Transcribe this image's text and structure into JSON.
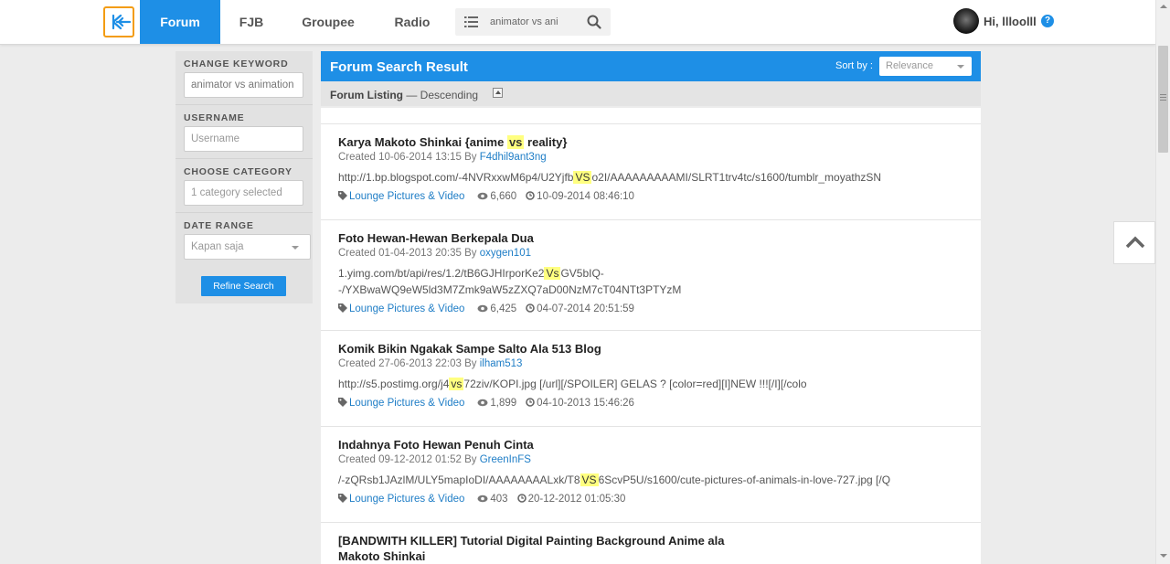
{
  "colors": {
    "brand_blue": "#1e8fe6",
    "logo_orange": "#f39c12",
    "highlight": "#ffff80",
    "link": "#1e7dc6"
  },
  "nav": {
    "logo_icon": "kaskus-k-logo",
    "tabs": [
      {
        "label": "Forum",
        "active": true
      },
      {
        "label": "FJB",
        "active": false
      },
      {
        "label": "Groupee",
        "active": false
      },
      {
        "label": "Radio",
        "active": false
      }
    ],
    "search": {
      "icon_left": "list-icon",
      "value": "animator vs ani",
      "icon_right": "search-icon"
    },
    "user": {
      "greeting": "Hi, llloolll",
      "help_icon": "question-circle-icon"
    }
  },
  "sidebar": {
    "change_keyword": {
      "label": "CHANGE KEYWORD",
      "value": "animator vs animation"
    },
    "username": {
      "label": "USERNAME",
      "placeholder": "Username"
    },
    "category": {
      "label": "CHOOSE CATEGORY",
      "value": "1 category selected"
    },
    "date_range": {
      "label": "DATE RANGE",
      "value": "Kapan saja"
    },
    "refine_button": "Refine Search"
  },
  "results_header": {
    "title": "Forum Search Result",
    "sort_label": "Sort by :",
    "sort_value": "Relevance",
    "listing_label": "Forum Listing",
    "listing_order": "— Descending"
  },
  "threads": [
    {
      "title_parts": [
        "Karya Makoto Shinkai {anime ",
        "vs",
        " reality}"
      ],
      "created_prefix": "Created 10-06-2014 13:15 By ",
      "author": "F4dhil9ant3ng",
      "snippet_parts": [
        "http://1.bp.blogspot.com/-4NVRxxwM6p4/U2Yjfb",
        "VS",
        "o2I/AAAAAAAAAMI/SLRT1trv4tc/s1600/tumblr_moyathzSN"
      ],
      "category": "Lounge Pictures & Video",
      "views": "6,660",
      "last_post": "10-09-2014 08:46:10"
    },
    {
      "title_parts": [
        "Foto Hewan-Hewan Berkepala Dua"
      ],
      "created_prefix": "Created 01-04-2013 20:35 By ",
      "author": "oxygen101",
      "snippet_parts": [
        "1.yimg.com/bt/api/res/1.2/tB6GJHIrporKe2",
        "Vs",
        "GV5bIQ--/YXBwaWQ9eW5ld3M7Zmk9aW5zZXQ7aD00NzM7cT04NTt3PTYzM"
      ],
      "category": "Lounge Pictures & Video",
      "views": "6,425",
      "last_post": "04-07-2014 20:51:59"
    },
    {
      "title_parts": [
        "Komik Bikin Ngakak Sampe Salto Ala 513 Blog"
      ],
      "created_prefix": "Created 27-06-2013 22:03 By ",
      "author": "ilham513",
      "snippet_parts": [
        "http://s5.postimg.org/j4",
        "vs",
        "72ziv/KOPI.jpg [/url][/SPOILER] GELAS ? [color=red][I]NEW !!![/I][/colo"
      ],
      "category": "Lounge Pictures & Video",
      "views": "1,899",
      "last_post": "04-10-2013 15:46:26"
    },
    {
      "title_parts": [
        "Indahnya Foto Hewan Penuh Cinta"
      ],
      "created_prefix": "Created 09-12-2012 01:52 By ",
      "author": "GreenInFS",
      "snippet_parts": [
        "/-zQRsb1JAzlM/ULY5mapIoDI/AAAAAAAALxk/T8",
        "VS",
        "6ScvP5U/s1600/cute-pictures-of-animals-in-love-727.jpg [/Q"
      ],
      "category": "Lounge Pictures & Video",
      "views": "403",
      "last_post": "20-12-2012 01:05:30"
    },
    {
      "title_parts": [
        "[BANDWITH KILLER] Tutorial Digital Painting Background Anime ala Makoto Shinkai"
      ],
      "created_prefix": "",
      "author": "",
      "snippet_parts": [],
      "category": "",
      "views": "",
      "last_post": ""
    }
  ]
}
